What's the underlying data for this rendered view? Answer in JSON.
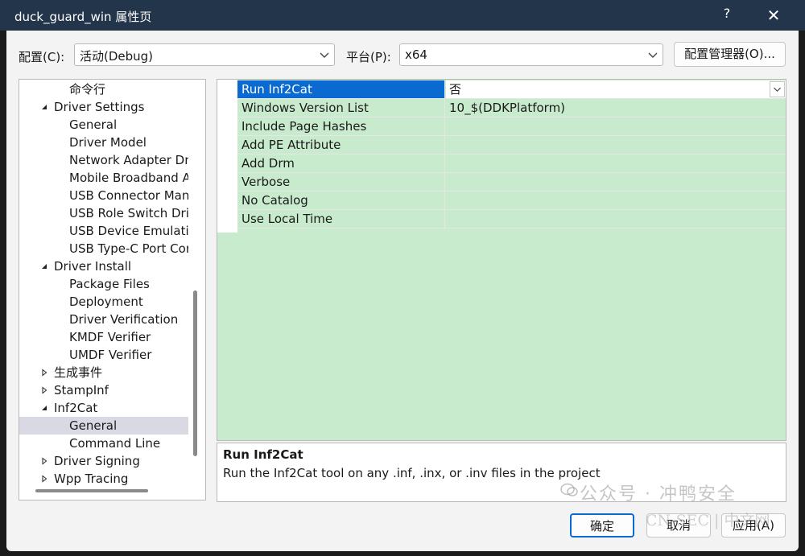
{
  "window": {
    "title": "duck_guard_win 属性页",
    "help": "?",
    "close": "✕"
  },
  "config_bar": {
    "config_label": "配置(C):",
    "config_value": "活动(Debug)",
    "platform_label": "平台(P):",
    "platform_value": "x64",
    "manager_button": "配置管理器(O)..."
  },
  "tree": {
    "items": [
      {
        "label": "命令行",
        "level": 2,
        "arrow": "none"
      },
      {
        "label": "Driver Settings",
        "level": 1,
        "arrow": "expanded"
      },
      {
        "label": "General",
        "level": 2,
        "arrow": "none"
      },
      {
        "label": "Driver Model",
        "level": 2,
        "arrow": "none"
      },
      {
        "label": "Network Adapter Dr",
        "level": 2,
        "arrow": "none"
      },
      {
        "label": "Mobile Broadband A",
        "level": 2,
        "arrow": "none"
      },
      {
        "label": "USB Connector Man",
        "level": 2,
        "arrow": "none"
      },
      {
        "label": "USB Role Switch Driv",
        "level": 2,
        "arrow": "none"
      },
      {
        "label": "USB Device Emulatic",
        "level": 2,
        "arrow": "none"
      },
      {
        "label": "USB Type-C Port Cor",
        "level": 2,
        "arrow": "none"
      },
      {
        "label": "Driver Install",
        "level": 1,
        "arrow": "expanded"
      },
      {
        "label": "Package Files",
        "level": 2,
        "arrow": "none"
      },
      {
        "label": "Deployment",
        "level": 2,
        "arrow": "none"
      },
      {
        "label": "Driver Verification",
        "level": 2,
        "arrow": "none"
      },
      {
        "label": "KMDF Verifier",
        "level": 2,
        "arrow": "none"
      },
      {
        "label": "UMDF Verifier",
        "level": 2,
        "arrow": "none"
      },
      {
        "label": "生成事件",
        "level": 1,
        "arrow": "collapsed"
      },
      {
        "label": "StampInf",
        "level": 1,
        "arrow": "collapsed"
      },
      {
        "label": "Inf2Cat",
        "level": 1,
        "arrow": "expanded"
      },
      {
        "label": "General",
        "level": 2,
        "arrow": "none",
        "selected": true
      },
      {
        "label": "Command Line",
        "level": 2,
        "arrow": "none"
      },
      {
        "label": "Driver Signing",
        "level": 1,
        "arrow": "collapsed"
      },
      {
        "label": "Wpp Tracing",
        "level": 1,
        "arrow": "collapsed"
      }
    ]
  },
  "properties": {
    "rows": [
      {
        "name": "Run Inf2Cat",
        "value": "否",
        "selected": true
      },
      {
        "name": "Windows Version List",
        "value": "10_$(DDKPlatform)"
      },
      {
        "name": "Include Page Hashes",
        "value": ""
      },
      {
        "name": "Add PE Attribute",
        "value": ""
      },
      {
        "name": "Add Drm",
        "value": ""
      },
      {
        "name": "Verbose",
        "value": ""
      },
      {
        "name": "No Catalog",
        "value": ""
      },
      {
        "name": "Use Local Time",
        "value": ""
      }
    ]
  },
  "description": {
    "title": "Run Inf2Cat",
    "text": "Run the Inf2Cat tool on any .inf, .inx, or .inv files in the project"
  },
  "buttons": {
    "ok": "确定",
    "cancel": "取消",
    "apply": "应用(A)"
  },
  "watermark": {
    "line1": "公众号 · 冲鸭安全",
    "line2": "CN-SEC | 中文网"
  },
  "colors": {
    "titlebar": "#22354a",
    "selection": "#0a6ad2",
    "grid_bg": "#c9ebcd",
    "tree_selection": "#d9d9e4"
  }
}
